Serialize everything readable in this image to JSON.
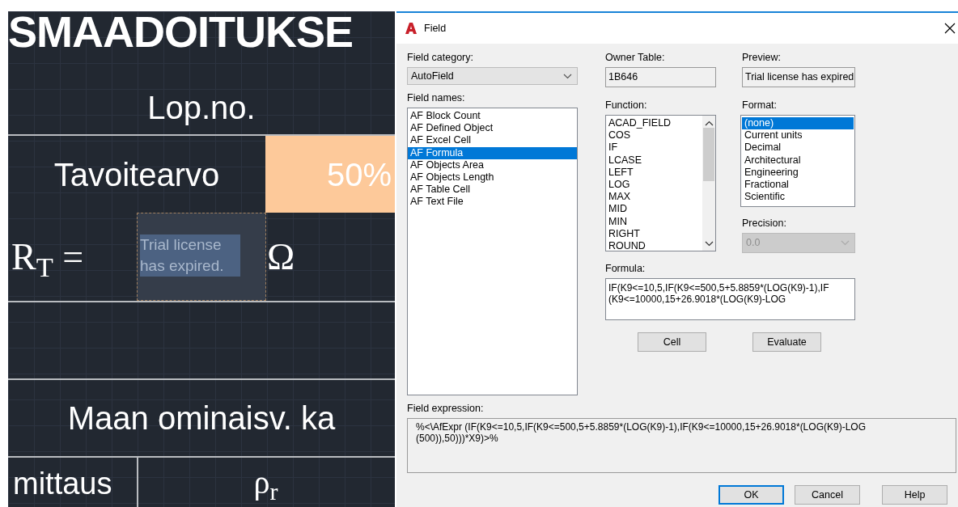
{
  "drawing": {
    "heading": "SMAADOITUKSE",
    "cells": [
      {
        "kind": "text",
        "text": "Lop.no."
      },
      {
        "kind": "text",
        "text": "Tavoitearvo"
      },
      {
        "kind": "fill",
        "text": "50%",
        "color": "#fdc99a"
      },
      {
        "kind": "math",
        "text": "R$_{T}$ ="
      },
      {
        "kind": "field",
        "text": "Trial license has expired.",
        "selected": true
      },
      {
        "kind": "math",
        "text": "Ω"
      },
      {
        "kind": "text",
        "text": "Maan ominaisv. ka"
      },
      {
        "kind": "text",
        "text": "mittaus"
      },
      {
        "kind": "math",
        "text": "ρ$_{r}$"
      }
    ]
  },
  "dialog": {
    "title": "Field",
    "field_category": {
      "label": "Field category:",
      "value": "AutoField"
    },
    "field_names": {
      "label": "Field names:",
      "items": [
        {
          "label": "AF Block Count",
          "selected": false
        },
        {
          "label": "AF Defined Object",
          "selected": false
        },
        {
          "label": "AF Excel Cell",
          "selected": false
        },
        {
          "label": "AF Formula",
          "selected": true
        },
        {
          "label": "AF Objects Area",
          "selected": false
        },
        {
          "label": "AF Objects Length",
          "selected": false
        },
        {
          "label": "AF Table Cell",
          "selected": false
        },
        {
          "label": "AF Text File",
          "selected": false
        }
      ]
    },
    "owner_table": {
      "label": "Owner Table:",
      "value": "1B646"
    },
    "function": {
      "label": "Function:",
      "items": [
        "ACAD_FIELD",
        "COS",
        "IF",
        "LCASE",
        "LEFT",
        "LOG",
        "MAX",
        "MID",
        "MIN",
        "RIGHT",
        "ROUND"
      ]
    },
    "preview": {
      "label": "Preview:",
      "value": "Trial license has expired"
    },
    "format": {
      "label": "Format:",
      "items": [
        {
          "label": "(none)",
          "selected": true
        },
        {
          "label": "Current units",
          "selected": false
        },
        {
          "label": "Decimal",
          "selected": false
        },
        {
          "label": "Architectural",
          "selected": false
        },
        {
          "label": "Engineering",
          "selected": false
        },
        {
          "label": "Fractional",
          "selected": false
        },
        {
          "label": "Scientific",
          "selected": false
        }
      ]
    },
    "precision": {
      "label": "Precision:",
      "value": "0.0",
      "disabled": true
    },
    "formula": {
      "label": "Formula:",
      "value": "IF(K9<=10,5,IF(K9<=500,5+5.8859*(LOG(K9)-1),IF (K9<=10000,15+26.9018*(LOG(K9)-LOG"
    },
    "formula_buttons": [
      "Cell",
      "Evaluate"
    ],
    "field_expression": {
      "label": "Field expression:",
      "value": "%<\\AfExpr (IF(K9<=10,5,IF(K9<=500,5+5.8859*(LOG(K9)-1),IF(K9<=10000,15+26.9018*(LOG(K9)-LOG (500)),50)))*X9)>%"
    },
    "buttons": [
      {
        "label": "OK",
        "default": true
      },
      {
        "label": "Cancel",
        "default": false
      },
      {
        "label": "Help",
        "default": false
      }
    ]
  }
}
